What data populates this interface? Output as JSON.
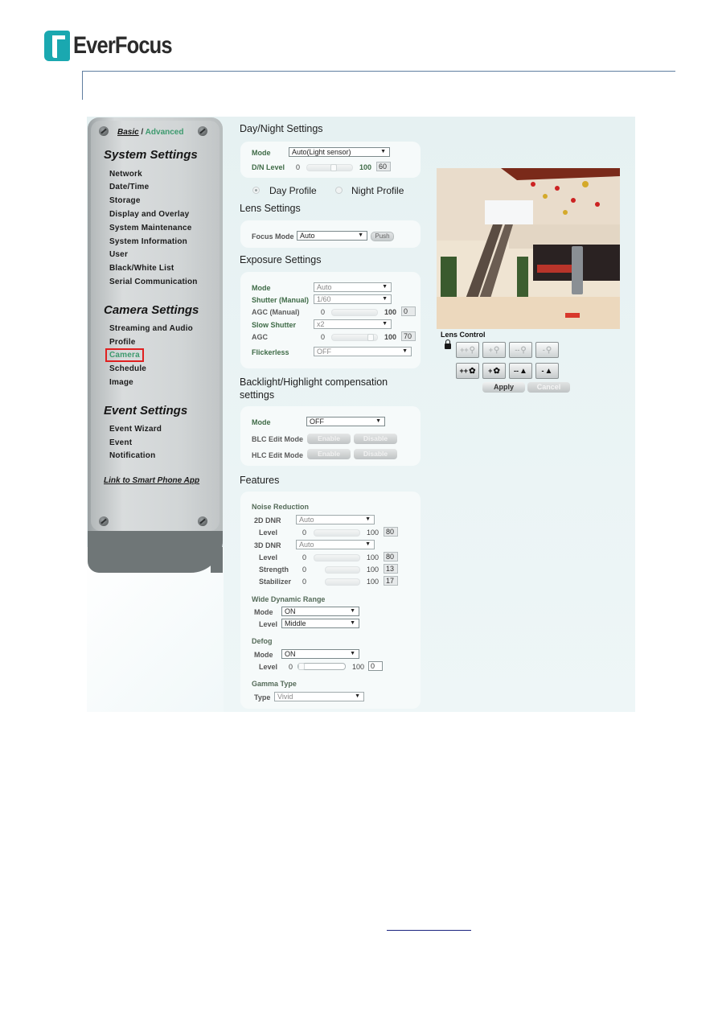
{
  "brand": {
    "name": "EverFocus",
    "color": "#1aa8b0"
  },
  "sidebar": {
    "basic_label": "Basic",
    "separator": "/",
    "advanced_label": "Advanced",
    "system_settings": {
      "heading": "System Settings",
      "items": [
        "Network",
        "Date/Time",
        "Storage",
        "Display and Overlay",
        "System Maintenance",
        "System Information",
        "User",
        "Black/White List",
        "Serial Communication"
      ]
    },
    "camera_settings": {
      "heading": "Camera Settings",
      "items": [
        "Streaming and Audio",
        "Profile",
        "Camera",
        "Schedule",
        "Image"
      ],
      "active": "Camera"
    },
    "event_settings": {
      "heading": "Event Settings",
      "items": [
        "Event Wizard",
        "Event",
        "Notification"
      ]
    },
    "smart_phone_link": "Link to Smart Phone App"
  },
  "day_night": {
    "title": "Day/Night Settings",
    "mode_label": "Mode",
    "mode_value": "Auto(Light sensor)",
    "dn_level_label": "D/N Level",
    "min": "0",
    "max": "100",
    "value": "60",
    "level_fraction": 0.6
  },
  "profiles": {
    "day": "Day Profile",
    "night": "Night Profile",
    "selected": "Day Profile"
  },
  "lens": {
    "title": "Lens Settings",
    "focus_mode_label": "Focus Mode",
    "focus_mode_value": "Auto",
    "push_label": "Push"
  },
  "exposure": {
    "title": "Exposure Settings",
    "mode_label": "Mode",
    "mode_value": "Auto",
    "shutter_label": "Shutter (Manual)",
    "shutter_value": "1/60",
    "agc_manual_label": "AGC (Manual)",
    "agc_manual_min": "0",
    "agc_manual_max": "100",
    "agc_manual_value": "0",
    "slow_shutter_label": "Slow Shutter",
    "slow_shutter_value": "x2",
    "agc_label": "AGC",
    "agc_min": "0",
    "agc_max": "100",
    "agc_value": "70",
    "flickerless_label": "Flickerless",
    "flickerless_value": "OFF"
  },
  "backlight": {
    "title_line1": "Backlight/Highlight compensation",
    "title_line2": "settings",
    "mode_label": "Mode",
    "mode_value": "OFF",
    "blc_label": "BLC Edit Mode",
    "hlc_label": "HLC Edit Mode",
    "enable_label": "Enable",
    "disable_label": "Disable"
  },
  "features": {
    "title": "Features",
    "noise_reduction": {
      "heading": "Noise Reduction",
      "dnr2d_label": "2D DNR",
      "dnr2d_value": "Auto",
      "level_label": "Level",
      "dnr2d_level": "80",
      "dnr3d_label": "3D DNR",
      "dnr3d_value": "Auto",
      "dnr3d_level": "80",
      "strength_label": "Strength",
      "strength_value": "13",
      "stabilizer_label": "Stabilizer",
      "stabilizer_value": "17",
      "min": "0",
      "max": "100"
    },
    "wdr": {
      "heading": "Wide Dynamic Range",
      "mode_label": "Mode",
      "mode_value": "ON",
      "level_label": "Level",
      "level_value": "Middle"
    },
    "defog": {
      "heading": "Defog",
      "mode_label": "Mode",
      "mode_value": "ON",
      "level_label": "Level",
      "min": "0",
      "max": "100",
      "value": "0"
    },
    "gamma": {
      "heading": "Gamma Type",
      "type_label": "Type",
      "type_value": "Vivid"
    }
  },
  "lens_control": {
    "title": "Lens Control",
    "zoom_buttons": [
      "++",
      "+",
      "--",
      "-"
    ],
    "focus_buttons": [
      "++",
      "+",
      "--",
      "-"
    ],
    "apply_label": "Apply",
    "cancel_label": "Cancel"
  },
  "dropdown_arrow": "▼"
}
